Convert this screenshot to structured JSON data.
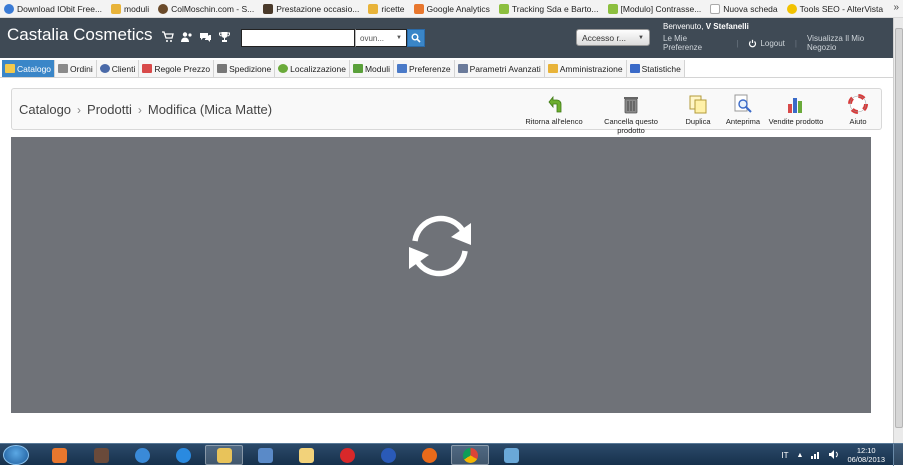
{
  "bookmarks": [
    {
      "label": "Download IObit Free...",
      "color": "#3a7bd5"
    },
    {
      "label": "moduli",
      "color": "#e8b339"
    },
    {
      "label": "ColMoschin.com - S...",
      "color": "#6a4a2a"
    },
    {
      "label": "Prestazione occasio...",
      "color": "#4a3a2a"
    },
    {
      "label": "ricette",
      "color": "#e8b339"
    },
    {
      "label": "Google Analytics",
      "color": "#e8772e"
    },
    {
      "label": "Tracking Sda e Barto...",
      "color": "#8cbf3f"
    },
    {
      "label": "[Modulo] Contrasse...",
      "color": "#8cbf3f"
    },
    {
      "label": "Nuova scheda",
      "color": "#dddddd"
    },
    {
      "label": "Tools SEO - AlterVista",
      "color": "#f2c200"
    }
  ],
  "bookmarks_more": "»",
  "header": {
    "brand": "Castalia Cosmetics",
    "quick_icons": [
      "cart-icon",
      "users-icon",
      "chat-icon",
      "trophy-icon"
    ],
    "search_value": "",
    "search_scope": "ovun...",
    "access_label": "Accesso r...",
    "welcome_prefix": "Benvenuto,",
    "welcome_name": "V Stefanelli",
    "link_preferences": "Le Mie Preferenze",
    "link_logout": "Logout",
    "link_shop": "Visualizza Il Mio Negozio"
  },
  "tabs": [
    {
      "label": "Catalogo",
      "icon": "folder-icon",
      "color": "#f2c94c",
      "active": true
    },
    {
      "label": "Ordini",
      "icon": "cart-icon",
      "color": "#8a8a8a"
    },
    {
      "label": "Clienti",
      "icon": "user-icon",
      "color": "#4a6aa8"
    },
    {
      "label": "Regole Prezzo",
      "icon": "price-icon",
      "color": "#d84a4a"
    },
    {
      "label": "Spedizione",
      "icon": "truck-icon",
      "color": "#777777"
    },
    {
      "label": "Localizzazione",
      "icon": "globe-icon",
      "color": "#6aaa3a"
    },
    {
      "label": "Moduli",
      "icon": "puzzle-icon",
      "color": "#5aa03a"
    },
    {
      "label": "Preferenze",
      "icon": "window-icon",
      "color": "#4a7ac8"
    },
    {
      "label": "Parametri Avanzati",
      "icon": "wrench-icon",
      "color": "#6a7a9a"
    },
    {
      "label": "Amministrazione",
      "icon": "key-icon",
      "color": "#e8b339"
    },
    {
      "label": "Statistiche",
      "icon": "chart-icon",
      "color": "#3a6ac8"
    }
  ],
  "breadcrumb": [
    "Catalogo",
    "Prodotti",
    "Modifica (Mica Matte)"
  ],
  "breadcrumb_sep": "›",
  "actions": [
    {
      "label": "Ritorna all'elenco",
      "icon": "back-arrow-icon"
    },
    {
      "label": "Cancella questo prodotto",
      "icon": "trash-icon"
    },
    {
      "label": "Duplica",
      "icon": "duplicate-icon"
    },
    {
      "label": "Anteprima",
      "icon": "preview-icon"
    },
    {
      "label": "Vendite prodotto",
      "icon": "sales-chart-icon"
    },
    {
      "label": "Aiuto",
      "icon": "lifebuoy-icon"
    }
  ],
  "taskbar": {
    "apps": [
      "media-player-icon",
      "app-icon",
      "sync-icon",
      "ie-icon",
      "explorer-icon",
      "app-icon-2",
      "notes-icon",
      "opera-icon",
      "app-icon-3",
      "firefox-icon",
      "chrome-icon",
      "network-app-icon"
    ],
    "language": "IT",
    "time": "12:10",
    "date": "06/08/2013"
  }
}
